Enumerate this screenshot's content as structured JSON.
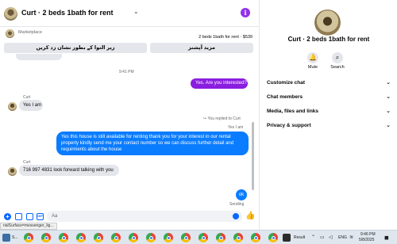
{
  "header": {
    "title": "Curt · 2 beds 1bath for rent",
    "chevron_icon": "chevron-down-icon",
    "info_icon": "info-icon"
  },
  "marketplace": {
    "label": "Marketplace",
    "listing": "2 beds 1bath for rent · $539",
    "button_1": "زیر التوا کے بطور نشان زد کریں",
    "button_2": "مزید آپشنز"
  },
  "messages": {
    "timestamp": "9:41 PM",
    "outgoing_1": "Yes. Are you interested?",
    "sender_1": "Curt",
    "incoming_1": "Yes I am",
    "reply_note": "You replied to Curt",
    "quoted": "Yes I am",
    "outgoing_2": "Yes this house is still available for renting thank you for your interest in our rental property kindly send me your contact number so we can discuss further detail and requirments about the house",
    "sender_2": "Curt",
    "incoming_2": "716 997 4831 look forward talking with you",
    "outgoing_3": "ok",
    "status": "Sending"
  },
  "composer": {
    "placeholder": "Aa"
  },
  "info_panel": {
    "title": "Curt · 2 beds 1bath for rent",
    "actions": [
      {
        "label": "Mute",
        "icon": "bell-icon"
      },
      {
        "label": "Search",
        "icon": "search-icon"
      }
    ],
    "sections": [
      {
        "label": "Customize chat"
      },
      {
        "label": "Chat members"
      },
      {
        "label": "Media, files and links"
      },
      {
        "label": "Privacy & support"
      }
    ]
  },
  "status_bar": {
    "url": "rialSurface=messenger_lig..."
  },
  "taskbar": {
    "first_label": "S...",
    "result_label": "Result",
    "language": "ENG",
    "time": "9:46 PM",
    "date": "5/8/2025"
  },
  "colors": {
    "messenger_blue": "#0a7cff",
    "purple_bubble": "#8a1ee0",
    "incoming_bubble": "#e4e6eb"
  }
}
